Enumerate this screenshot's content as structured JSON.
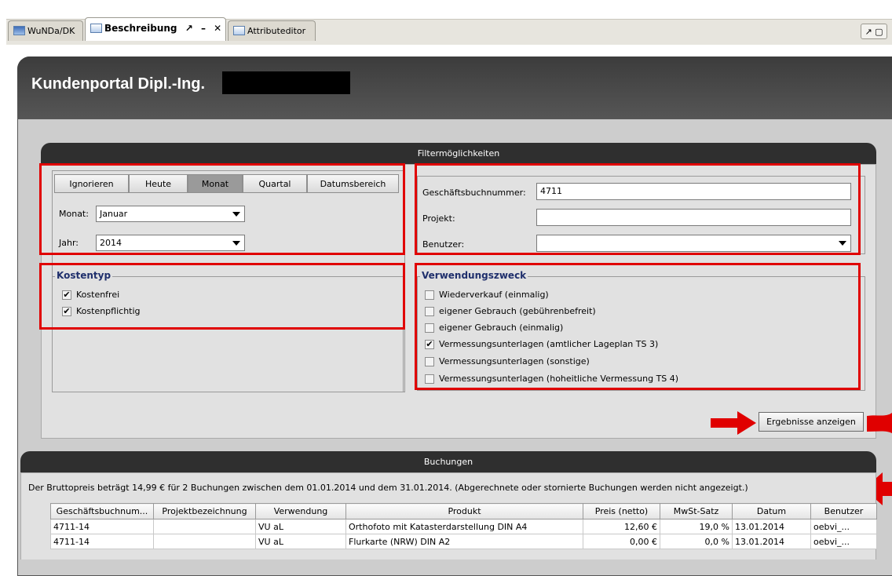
{
  "tabs": [
    {
      "label": "WuNDa/DK",
      "icon": "map-icon"
    },
    {
      "label": "Beschreibung",
      "icon": "document-icon",
      "active": true
    },
    {
      "label": "Attributeditor",
      "icon": "table-icon"
    }
  ],
  "tab_controls": {
    "pin": "↗",
    "minimize": "–",
    "close": "✕",
    "corner": "↗ ▢"
  },
  "portal": {
    "title": "Kundenportal Dipl.-Ing."
  },
  "filter": {
    "title": "Filtermöglichkeiten",
    "period_tabs": [
      "Ignorieren",
      "Heute",
      "Monat",
      "Quartal",
      "Datumsbereich"
    ],
    "selected_period": "Monat",
    "month_label": "Monat:",
    "month_value": "Januar",
    "year_label": "Jahr:",
    "year_value": "2014",
    "booking_number_label": "Geschäftsbuchnummer:",
    "booking_number_value": "4711",
    "project_label": "Projekt:",
    "project_value": "",
    "user_label": "Benutzer:",
    "user_value": "",
    "cost_type": {
      "title": "Kostentyp",
      "items": [
        {
          "label": "Kostenfrei",
          "checked": true
        },
        {
          "label": "Kostenpflichtig",
          "checked": true
        }
      ]
    },
    "purpose": {
      "title": "Verwendungszweck",
      "items": [
        {
          "label": "Wiederverkauf (einmalig)",
          "checked": false
        },
        {
          "label": "eigener Gebrauch (gebührenbefreit)",
          "checked": false
        },
        {
          "label": "eigener Gebrauch (einmalig)",
          "checked": false
        },
        {
          "label": "Vermessungsunterlagen (amtlicher Lageplan TS 3)",
          "checked": true
        },
        {
          "label": "Vermessungsunterlagen (sonstige)",
          "checked": false
        },
        {
          "label": "Vermessungsunterlagen (hoheitliche Vermessung TS 4)",
          "checked": false
        }
      ]
    },
    "show_results_button": "Ergebnisse anzeigen"
  },
  "bookings": {
    "title": "Buchungen",
    "info": "Der Bruttopreis beträgt 14,99 € für 2 Buchungen zwischen dem 01.01.2014 und dem 31.01.2014. (Abgerechnete oder stornierte Buchungen werden nicht angezeigt.)",
    "columns": [
      "Geschäftsbuchnum...",
      "Projektbezeichnung",
      "Verwendung",
      "Produkt",
      "Preis (netto)",
      "MwSt-Satz",
      "Datum",
      "Benutzer"
    ],
    "rows": [
      [
        "4711-14",
        "",
        "VU aL",
        "Orthofoto mit Katasterdarstellung DIN A4",
        "12,60 €",
        "19,0 %",
        "13.01.2014",
        "oebvi_..."
      ],
      [
        "4711-14",
        "",
        "VU aL",
        "Flurkarte (NRW) DIN A2",
        "0,00 €",
        "0,0 %",
        "13.01.2014",
        "oebvi_..."
      ]
    ]
  },
  "colors": {
    "highlight": "#e00000",
    "header_dark": "#2f2f2f",
    "panel": "#cdcdcd"
  }
}
